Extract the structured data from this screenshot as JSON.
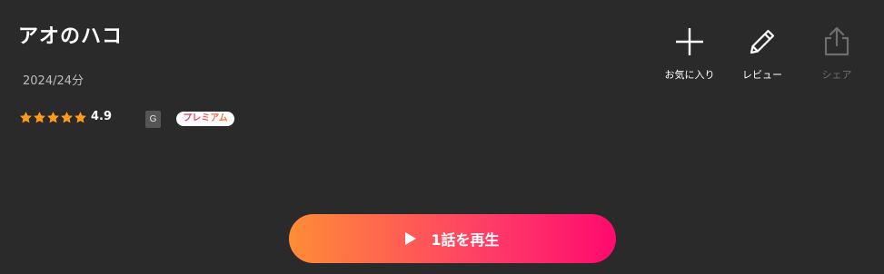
{
  "title": "アオのハコ",
  "meta": "2024/24分",
  "rating": {
    "stars": 5,
    "value": "4.9"
  },
  "age_rating": "G",
  "premium_badge": "プレミアム",
  "actions": {
    "favorite": {
      "label": "お気に入り",
      "icon": "plus-icon"
    },
    "review": {
      "label": "レビュー",
      "icon": "pencil-icon"
    },
    "share": {
      "label": "シェア",
      "icon": "share-icon",
      "disabled": true
    }
  },
  "play_button": {
    "label": "1話を再生",
    "icon": "play-icon"
  },
  "colors": {
    "background": "#2a2a2a",
    "star": "#ff9a1a",
    "play_gradient_start": "#ff8c36",
    "play_gradient_end": "#ff0a6e",
    "premium_text": "#e0307a",
    "disabled": "#6e6e6e"
  }
}
